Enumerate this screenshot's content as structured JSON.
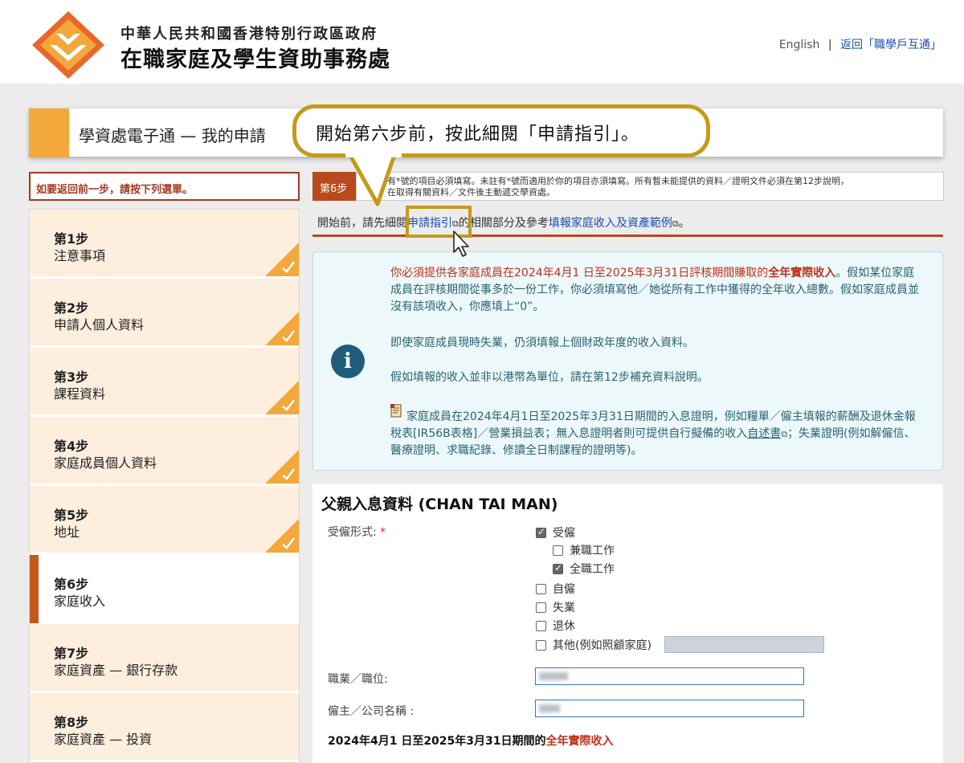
{
  "header": {
    "org_line1": "中華人民共和國香港特別行政區政府",
    "org_line2": "在職家庭及學生資助事務處",
    "lang_link": "English",
    "separator": "|",
    "back_link": "返回「職學戶互通」"
  },
  "title_bar": {
    "title": "學資處電子通 — 我的申請"
  },
  "callout": {
    "text": "開始第六步前，按此細閱「申請指引」。"
  },
  "sidebar": {
    "back_hint": "如要返回前一步，請按下列選單。",
    "steps": [
      {
        "num": "第1步",
        "name": "注意事項",
        "done": true
      },
      {
        "num": "第2步",
        "name": "申請人個人資料",
        "done": true
      },
      {
        "num": "第3步",
        "name": "課程資料",
        "done": true
      },
      {
        "num": "第4步",
        "name": "家庭成員個人資料",
        "done": true
      },
      {
        "num": "第5步",
        "name": "地址",
        "done": true
      },
      {
        "num": "第6步",
        "name": "家庭收入",
        "done": false,
        "active": true
      },
      {
        "num": "第7步",
        "name": "家庭資產 — 銀行存款",
        "done": false
      },
      {
        "num": "第8步",
        "name": "家庭資產 — 投資",
        "done": false
      }
    ]
  },
  "main": {
    "step_badge": "第6步",
    "notice_line1": "有*號的項目必須填寫。未註有*號而適用於你的項目亦須填寫。所有暫未能提供的資料／證明文件必須在第12步說明，",
    "notice_line2": "在取得有關資料／文件後主動遞交學資處。",
    "before": {
      "prefix": "開始前，請先細閱",
      "guide_link": "申請指引",
      "middle": "的相關部分及參考",
      "example_link": "填報家庭收入及資產範例",
      "suffix": "。"
    },
    "info": {
      "p1_red_a": "你必須提供各家庭成員在2024年4月1 日至2025年3月31日評核期間賺取的",
      "p1_bold": "全年實際收入",
      "p1_rest": "。假如某位家庭成員在評核期間從事多於一份工作，你必須填寫他／她從所有工作中獲得的全年收入總數。假如家庭成員並沒有該項收入，你應填上“0”。",
      "p2": "即使家庭成員現時失業，仍須填報上個財政年度的收入資料。",
      "p3": "假如填報的收入並非以港幣為單位，請在第12步補充資料說明。",
      "p4_a": "家庭成員在2024年4月1日至2025年3月31日期間的入息證明，例如糧單／僱主填報的薪酬及退休金報稅表[IR56B表格]／營業損益表；無入息證明者則可提供自行擬備的收入",
      "p4_link": "自述書",
      "p4_b": "；失業證明(例如解僱信、醫療證明、求職紀錄、修讀全日制課程的證明等)。"
    },
    "form": {
      "title": "父親入息資料 (CHAN TAI MAN)",
      "employment_label": "受僱形式:",
      "required_mark": "*",
      "opt_employed": "受僱",
      "opt_part_time": "兼職工作",
      "opt_full_time": "全職工作",
      "opt_self": "自僱",
      "opt_unemployed": "失業",
      "opt_retired": "退休",
      "opt_other": "其他(例如照顧家庭)",
      "occupation_label": "職業／職位:",
      "employer_label": "僱主／公司名稱 :",
      "period_a": "2024年4月1 日至2025年3月31日期間的",
      "period_red": "全年實際收入"
    }
  },
  "colors": {
    "brand_orange": "#f3a83b",
    "brand_red": "#b84a1d",
    "callout_gold": "#c59a1b",
    "info_text": "#2a6373",
    "link_blue": "#1c4fa8"
  }
}
